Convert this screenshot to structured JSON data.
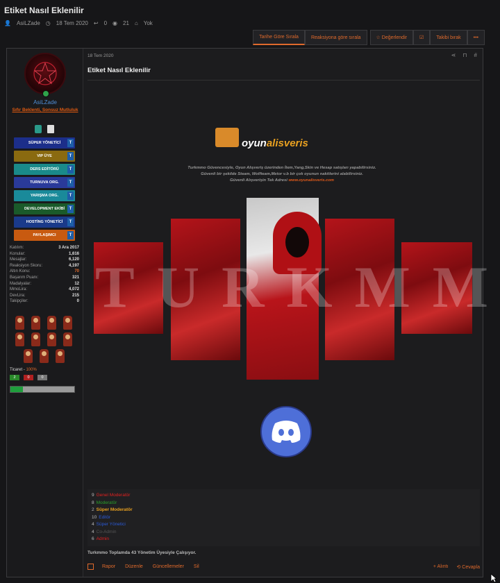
{
  "thread": {
    "title": "Etiket Nasıl Eklenilir",
    "author": "AsiLZade",
    "date": "18 Tem 2020",
    "replies": "0",
    "views": "21",
    "tags": "Yok"
  },
  "toolbar": {
    "sort_date": "Tarihe Göre Sırala",
    "sort_reaction": "Reaksiyona göre sırala",
    "rate": "Değerlendir",
    "follow": "Takibi bırak",
    "more": "•••"
  },
  "user": {
    "name": "AsiLZade",
    "title": "Sıfır Beklenti, Sonsuz Mutluluk",
    "banners": [
      {
        "label": "SÜPER YÖNETİCİ",
        "color": "#1c2e8a"
      },
      {
        "label": "VIP ÜYE",
        "color": "#8a6a10"
      },
      {
        "label": "DERS EDİTÖRÜ",
        "color": "#1a8a8a"
      },
      {
        "label": "TURNUVA ORG.",
        "color": "#2a3a9a"
      },
      {
        "label": "YARIŞMA ORG.",
        "color": "#1a8a9a"
      },
      {
        "label": "DEVELOPMENT EKİBİ",
        "color": "#1a5a2a"
      },
      {
        "label": "HOSTİNG YÖNETİCİ",
        "color": "#1a3a8a"
      },
      {
        "label": "PAYLAŞIMCI",
        "color": "#c85a10"
      }
    ],
    "stats": [
      {
        "label": "Katılım:",
        "value": "3 Ara 2017"
      },
      {
        "label": "Konular:",
        "value": "1,616"
      },
      {
        "label": "Mesajlar:",
        "value": "6,120"
      },
      {
        "label": "Reaksiyon Skoru:",
        "value": "4,197"
      },
      {
        "label": "Altın Konu:",
        "value": "70"
      },
      {
        "label": "Başarım Puanı:",
        "value": "321"
      },
      {
        "label": "Madalyalar:",
        "value": "12"
      },
      {
        "label": "MmoLira:",
        "value": "4,072"
      },
      {
        "label": "DevLira:",
        "value": "215"
      },
      {
        "label": "Takipçiler:",
        "value": "0"
      }
    ],
    "ticaret_label": "Ticaret -",
    "ticaret_percent": "100%",
    "ticaret_boxes": [
      {
        "value": "2",
        "color": "#2a8a2a"
      },
      {
        "value": "0",
        "color": "#b02020"
      },
      {
        "value": "0",
        "color": "#777777"
      }
    ],
    "progress": 0.2
  },
  "post": {
    "date": "18 Tem 2020",
    "title": "Etiket Nasıl Eklenilir",
    "logo_text_1": "oyun",
    "logo_text_2": "alisveris",
    "promo_lines": [
      "Turkmmo Güvencesiyle, Oyun Alışveriş üzerinden İtem,Yang,Skin ve Hesap satışları yapabilirsiniz.",
      "Güvenli bir şekilde Steam, Wolfteam,Metor v.b bir çok oyunun nakitlerini alabilirsiniz.",
      "Güvenli Alışverişin Tek Adresi"
    ],
    "promo_link": "www.oyunalisveris.com",
    "art_text": "TURKMMO",
    "staff": [
      {
        "count": "9",
        "role": "Genel Moderatör",
        "color": "#e02020"
      },
      {
        "count": "8",
        "role": "Moderatör",
        "color": "#2aa02a"
      },
      {
        "count": "2",
        "role": "Süper Moderatör",
        "color": "#e8a020"
      },
      {
        "count": "10",
        "role": "Editör",
        "color": "#2a5ad8"
      },
      {
        "count": "4",
        "role": "Süper Yönetici",
        "color": "#2a5ad8"
      },
      {
        "count": "4",
        "role": "Co-Admin",
        "color": "#555555"
      },
      {
        "count": "6",
        "role": "Admin",
        "color": "#e02020"
      }
    ],
    "footer_text": "Turkmmo Toplamda 43 Yönetim Üyesiyle Çalışıyor."
  },
  "actions": {
    "report": "Rapor",
    "edit": "Düzenle",
    "updates": "Güncellemeler",
    "delete": "Sil",
    "quote": "+ Alıntı",
    "reply": "⟲ Cevapla"
  }
}
